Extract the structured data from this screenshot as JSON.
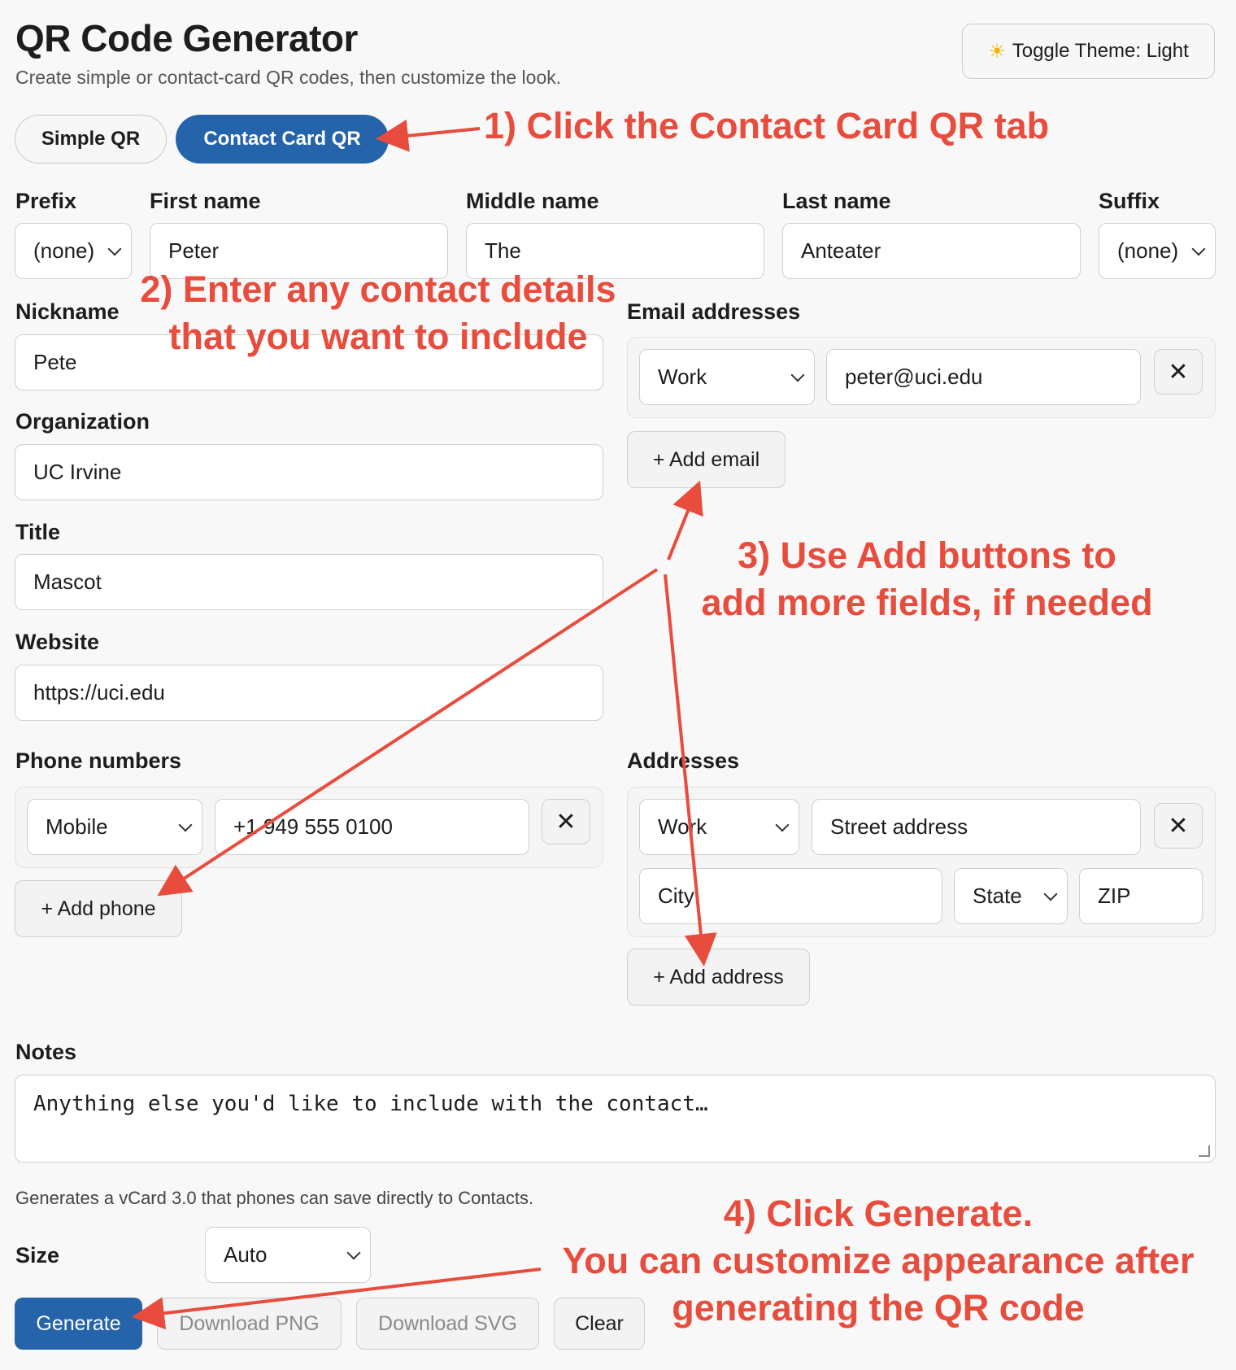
{
  "header": {
    "title": "QR Code Generator",
    "subtitle": "Create simple or contact-card QR codes, then customize the look.",
    "theme_button": "Toggle Theme: Light",
    "theme_icon": "sun-icon"
  },
  "tabs": [
    {
      "label": "Simple QR",
      "active": false
    },
    {
      "label": "Contact Card QR",
      "active": true
    }
  ],
  "form": {
    "prefix": {
      "label": "Prefix",
      "value": "(none)"
    },
    "first_name": {
      "label": "First name",
      "value": "Peter"
    },
    "middle_name": {
      "label": "Middle name",
      "value": "The"
    },
    "last_name": {
      "label": "Last name",
      "value": "Anteater"
    },
    "suffix": {
      "label": "Suffix",
      "value": "(none)"
    },
    "nickname": {
      "label": "Nickname",
      "value": "Pete"
    },
    "organization": {
      "label": "Organization",
      "value": "UC Irvine"
    },
    "title": {
      "label": "Title",
      "value": "Mascot"
    },
    "website": {
      "label": "Website",
      "value": "https://uci.edu"
    },
    "emails": {
      "label": "Email addresses",
      "items": [
        {
          "type": "Work",
          "value": "peter@uci.edu"
        }
      ],
      "add_label": "+ Add email"
    },
    "phones": {
      "label": "Phone numbers",
      "items": [
        {
          "type": "Mobile",
          "value": "+1 949 555 0100"
        }
      ],
      "add_label": "+ Add phone"
    },
    "addresses": {
      "label": "Addresses",
      "items": [
        {
          "type": "Work",
          "street_placeholder": "Street address",
          "city_placeholder": "City",
          "state": "State",
          "zip_placeholder": "ZIP"
        }
      ],
      "add_label": "+ Add address"
    },
    "notes": {
      "label": "Notes",
      "placeholder": "Anything else you'd like to include with the contact…"
    },
    "hint": "Generates a vCard 3.0 that phones can save directly to Contacts.",
    "size": {
      "label": "Size",
      "value": "Auto"
    }
  },
  "actions": {
    "generate": "Generate",
    "download_png": "Download PNG",
    "download_svg": "Download SVG",
    "clear": "Clear"
  },
  "annotations": {
    "step1": "1) Click the Contact Card QR tab",
    "step2_line1": "2) Enter any contact details",
    "step2_line2": "that you want to include",
    "step3_line1": "3) Use Add buttons to",
    "step3_line2": "add more fields, if needed",
    "step4_line1": "4) Click Generate.",
    "step4_line2": "You can customize appearance after",
    "step4_line3": "generating the QR code",
    "color": "#e84c3d"
  },
  "colors": {
    "accent": "#2563ab",
    "background": "#f8f8f8"
  }
}
